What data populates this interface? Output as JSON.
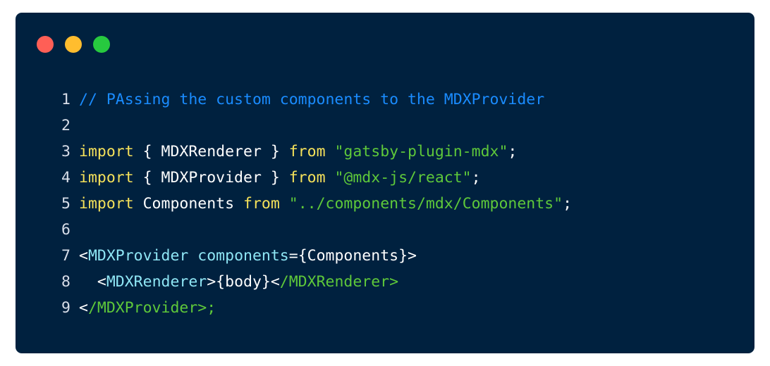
{
  "window": {
    "controls": [
      {
        "name": "close",
        "color": "#ff5f56"
      },
      {
        "name": "minimize",
        "color": "#ffbd2e"
      },
      {
        "name": "maximize",
        "color": "#27c93f"
      }
    ]
  },
  "code": {
    "lines": [
      {
        "num": "1",
        "tokens": [
          {
            "t": "// PAssing the custom components to the MDXProvider",
            "k": "comment"
          }
        ]
      },
      {
        "num": "2",
        "tokens": []
      },
      {
        "num": "3",
        "tokens": [
          {
            "t": "import",
            "k": "keyword"
          },
          {
            "t": " { MDXRenderer } ",
            "k": "plain"
          },
          {
            "t": "from",
            "k": "keyword"
          },
          {
            "t": " ",
            "k": "plain"
          },
          {
            "t": "\"gatsby-plugin-mdx\"",
            "k": "string"
          },
          {
            "t": ";",
            "k": "plain"
          }
        ]
      },
      {
        "num": "4",
        "tokens": [
          {
            "t": "import",
            "k": "keyword"
          },
          {
            "t": " { MDXProvider } ",
            "k": "plain"
          },
          {
            "t": "from",
            "k": "keyword"
          },
          {
            "t": " ",
            "k": "plain"
          },
          {
            "t": "\"@mdx-js/react\"",
            "k": "string"
          },
          {
            "t": ";",
            "k": "plain"
          }
        ]
      },
      {
        "num": "5",
        "tokens": [
          {
            "t": "import",
            "k": "keyword"
          },
          {
            "t": " Components ",
            "k": "plain"
          },
          {
            "t": "from",
            "k": "keyword"
          },
          {
            "t": " ",
            "k": "plain"
          },
          {
            "t": "\"../components/mdx/Components\"",
            "k": "string"
          },
          {
            "t": ";",
            "k": "plain"
          }
        ]
      },
      {
        "num": "6",
        "tokens": []
      },
      {
        "num": "7",
        "tokens": [
          {
            "t": "<",
            "k": "plain"
          },
          {
            "t": "MDXProvider",
            "k": "tag"
          },
          {
            "t": " ",
            "k": "plain"
          },
          {
            "t": "components",
            "k": "tag"
          },
          {
            "t": "={Components}>",
            "k": "plain"
          }
        ]
      },
      {
        "num": "8",
        "tokens": [
          {
            "t": "  <",
            "k": "plain"
          },
          {
            "t": "MDXRenderer",
            "k": "tag"
          },
          {
            "t": ">{body}<",
            "k": "plain"
          },
          {
            "t": "/MDXRenderer>",
            "k": "tagclose"
          }
        ]
      },
      {
        "num": "9",
        "tokens": [
          {
            "t": "<",
            "k": "plain"
          },
          {
            "t": "/MDXProvider>;",
            "k": "tagclose"
          }
        ]
      }
    ]
  }
}
